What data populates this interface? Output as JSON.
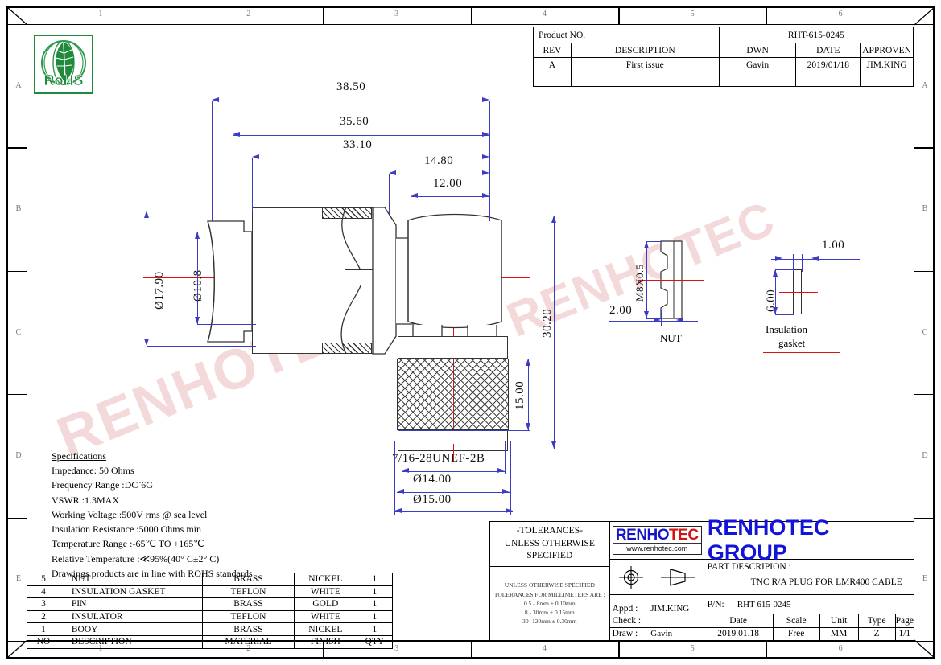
{
  "sheet": {
    "columns_top": [
      "1",
      "2",
      "3",
      "4",
      "5",
      "6"
    ],
    "columns_bottom": [
      "1",
      "2",
      "3",
      "4",
      "5",
      "6"
    ],
    "rows": [
      "A",
      "B",
      "C",
      "D",
      "E"
    ]
  },
  "rohs": {
    "label": "RoHS"
  },
  "revision_block": {
    "product_no_label": "Product NO.",
    "product_no_value": "RHT-615-0245",
    "headers": [
      "REV",
      "DESCRIPTION",
      "DWN",
      "DATE",
      "APPROVEN"
    ],
    "rows": [
      [
        "A",
        "First issue",
        "Gavin",
        "2019/01/18",
        "JIM.KING"
      ],
      [
        "",
        "",
        "",
        "",
        ""
      ]
    ]
  },
  "dimensions": {
    "overall_38_50": "38.50",
    "overall_35_60": "35.60",
    "overall_33_10": "33.10",
    "d_14_80": "14.80",
    "d_12_00": "12.00",
    "dia_17_90": "Ø17.90",
    "dia_10_8": "Ø10.8",
    "height_30_20": "30.20",
    "height_15_00": "15.00",
    "thread": "7/16-28UNEF-2B",
    "dia_14_00": "Ø14.00",
    "dia_15_00": "Ø15.00"
  },
  "nut_detail": {
    "thread": "M8X0.5",
    "thickness": "2.00",
    "caption": "NUT"
  },
  "gasket_detail": {
    "width": "1.00",
    "height": "6.00",
    "caption_line1": "Insulation",
    "caption_line2": "gasket"
  },
  "specifications": {
    "heading": "Specifications",
    "lines": [
      "Impedance: 50 Ohms",
      "Frequency Range :DC˜6G",
      "VSWR :1.3MAX",
      "Working Voltage :500V rms @ sea level",
      "Insulation Resistance :5000 Ohms min",
      "Temperature Range :-65℃ TO +165℃",
      "Relative Temperature :≪95%(40° C±2° C)",
      "Drawings products are in line with ROHS standards"
    ]
  },
  "bom": {
    "headers": [
      "NO",
      "DESCRIPTION",
      "MATERIAL",
      "FINISH",
      "QTY"
    ],
    "rows": [
      [
        "5",
        "NUT",
        "BRASS",
        "NICKEL",
        "1"
      ],
      [
        "4",
        "INSULATION GASKET",
        "TEFLON",
        "WHITE",
        "1"
      ],
      [
        "3",
        "PIN",
        "BRASS",
        "GOLD",
        "1"
      ],
      [
        "2",
        "INSULATOR",
        "TEFLON",
        "WHITE",
        "1"
      ],
      [
        "1",
        "BOOY",
        "BRASS",
        "NICKEL",
        "1"
      ]
    ]
  },
  "title_block": {
    "tolerance_heading": [
      "-TOLERANCES-",
      "UNLESS OTHERWISE",
      "SPECIFIED"
    ],
    "tolerance_detail": [
      "UNLESS OTHERWISE SPECIFIED",
      "TOLERANCES FOR MILLIMETERS ARE :",
      "0.5 - 8mm ± 0.10mm",
      "8 - 30mm ± 0.15mm",
      "30 -120mm ± 0.30mm"
    ],
    "logo_word_blue": "RENHO",
    "logo_word_red": "TEC",
    "logo_url": "www.renhotec.com",
    "company": "RENHOTEC GROUP",
    "part_description_label": "PART DESCRIPION :",
    "part_description_value": "TNC R/A PLUG FOR LMR400 CABLE",
    "appd_label": "Appd :",
    "appd_value": "JIM.KING",
    "pn_label": "P/N:",
    "pn_value": "RHT-615-0245",
    "check_label": "Check :",
    "check_value": "",
    "draw_label": "Draw :",
    "draw_value": "Gavin",
    "headers": [
      "Date",
      "Scale",
      "Unit",
      "Type",
      "Page"
    ],
    "values": [
      "2019.01.18",
      "Free",
      "MM",
      "Z",
      "1/1"
    ]
  },
  "watermark": {
    "text": "RENHOTEC"
  },
  "colors": {
    "dimension_blue": "#3b3bc4",
    "centerline_red": "#dd1111",
    "logo_blue": "#1414d8",
    "logo_red": "#d01414",
    "rohs_green": "#1f8a3c"
  }
}
